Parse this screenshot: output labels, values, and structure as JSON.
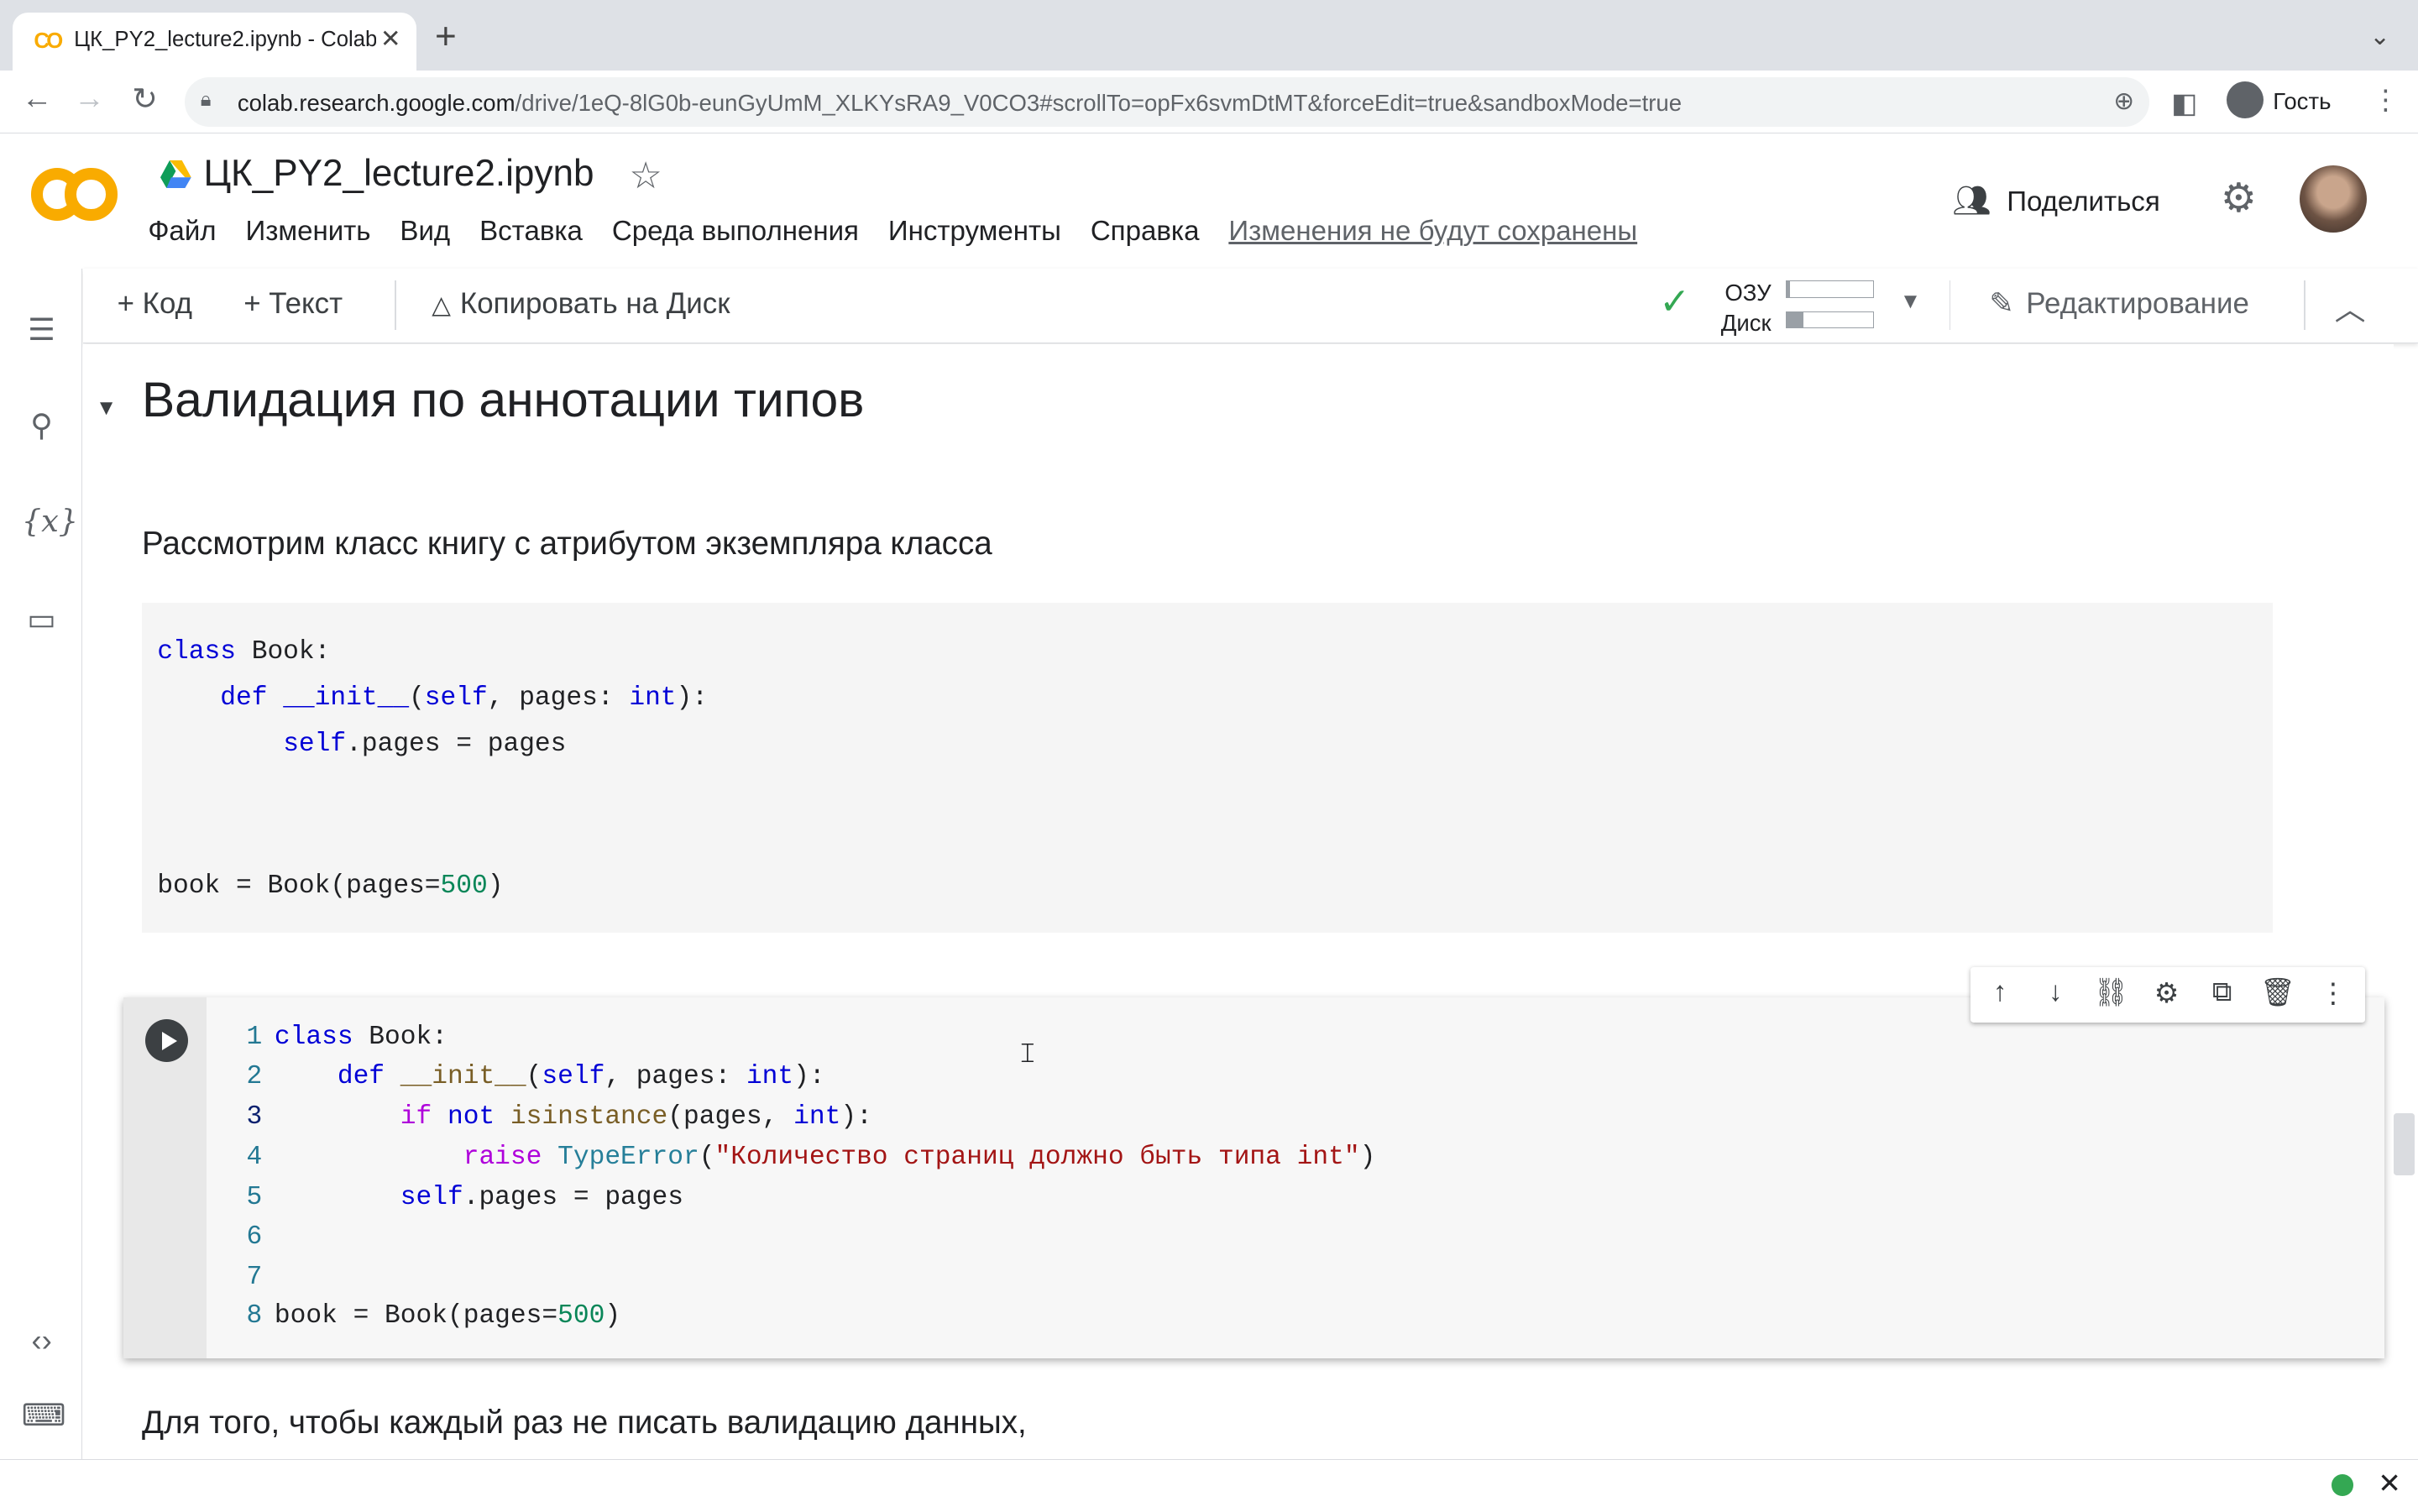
{
  "browser": {
    "tab_title": "ЦК_PY2_lecture2.ipynb - Colab",
    "tab_favicon": "CO",
    "url_domain": "colab.research.google.com",
    "url_path": "/drive/1eQ-8lG0b-eunGyUmM_XLKYsRA9_V0CO3#scrollTo=opFx6svmDtMT&forceEdit=true&sandboxMode=true",
    "profile_name": "Гость"
  },
  "colab": {
    "notebook_title": "ЦК_PY2_lecture2.ipynb",
    "menu": [
      "Файл",
      "Изменить",
      "Вид",
      "Вставка",
      "Среда выполнения",
      "Инструменты",
      "Справка"
    ],
    "unsaved_notice": "Изменения не будут сохранены",
    "share_label": "Поделиться"
  },
  "toolbar": {
    "add_code": "+ Код",
    "add_text": "+ Текст",
    "copy_to_drive": "Копировать на Диск",
    "ram_label": "ОЗУ",
    "disk_label": "Диск",
    "ram_usage": 0.04,
    "disk_usage": 0.2,
    "edit_label": "Редактирование"
  },
  "content": {
    "section_title": "Валидация по аннотации типов",
    "para1": "Рассмотрим класс книгу с атрибутом экземпляра класса",
    "para2": "Для того, чтобы каждый раз не писать валидацию данных,"
  },
  "colors": {
    "accent_orange": "#f9ab00",
    "status_green": "#34a853",
    "keyword": "#0000d6",
    "number": "#098658",
    "string": "#a31515"
  },
  "code1_lines": [
    "class Book:",
    "    def __init__(self, pages: int):",
    "        self.pages = pages",
    "",
    "",
    "book = Book(pages=500)"
  ],
  "code2_lines": [
    "class Book:",
    "    def __init__(self, pages: int):",
    "        if not isinstance(pages, int):",
    "            raise TypeError(\"Количество страниц должно быть типа int\")",
    "        self.pages = pages",
    "",
    "",
    "book = Book(pages=500)"
  ],
  "code2_line_numbers": [
    "1",
    "2",
    "3",
    "4",
    "5",
    "6",
    "7",
    "8"
  ]
}
